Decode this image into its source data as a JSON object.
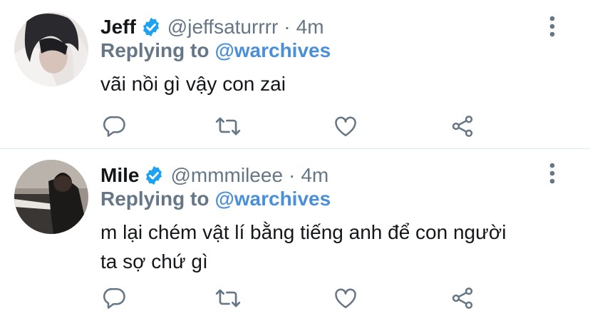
{
  "tweets": [
    {
      "display_name": "Jeff",
      "handle": "@jeffsaturrrr",
      "separator": "·",
      "time": "4m",
      "replying_prefix": "Replying to",
      "replying_to": "@warchives",
      "text_lines": [
        "vãi nồi gì vậy con zai"
      ]
    },
    {
      "display_name": "Mile",
      "handle": "@mmmileee",
      "separator": "·",
      "time": "4m",
      "replying_prefix": "Replying to",
      "replying_to": "@warchives",
      "text_lines": [
        "m lại chém vật lí bằng tiếng anh để con người",
        "ta sợ chứ gì"
      ]
    }
  ],
  "icons": {
    "verified": "verified-badge-icon",
    "more": "more-vertical-icon",
    "reply": "reply-icon",
    "retweet": "retweet-icon",
    "like": "heart-icon",
    "share": "share-icon"
  },
  "colors": {
    "accent": "#1da1f2",
    "mention": "#4a90d9",
    "secondary_text": "#657786",
    "primary_text": "#14171a",
    "divider": "#e1e8ed"
  }
}
